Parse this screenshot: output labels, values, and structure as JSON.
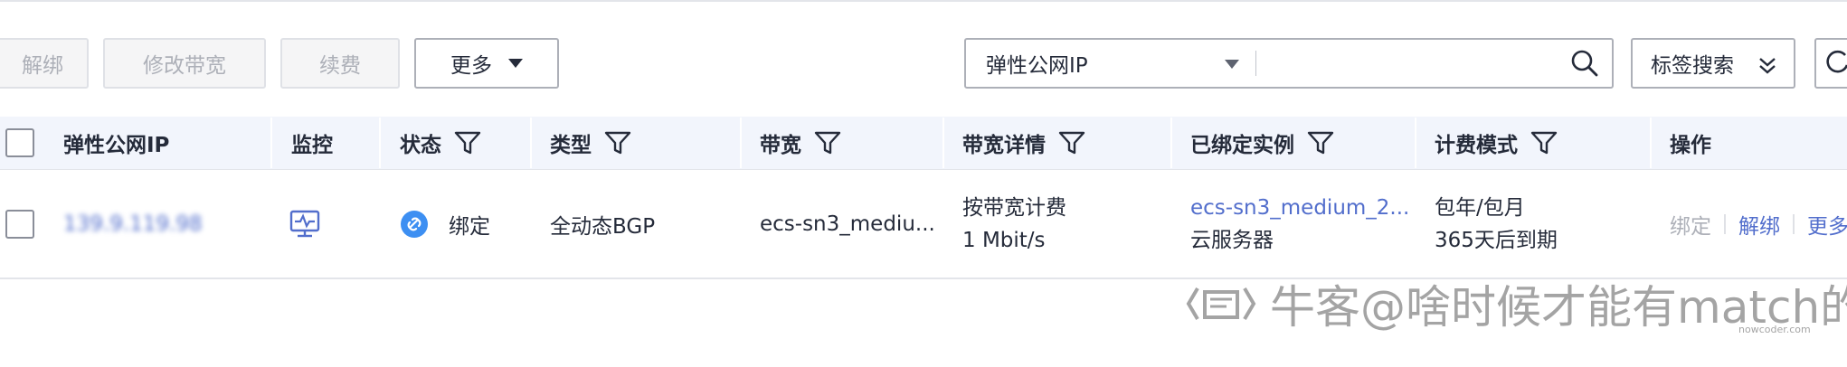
{
  "toolbar": {
    "unbind_label": "解绑",
    "modify_bandwidth_label": "修改带宽",
    "renew_label": "续费",
    "more_label": "更多"
  },
  "search": {
    "field_selected": "弹性公网IP",
    "query_value": "",
    "tag_search_label": "标签搜索"
  },
  "table": {
    "headers": {
      "eip": "弹性公网IP",
      "monitor": "监控",
      "status": "状态",
      "type": "类型",
      "bandwidth": "带宽",
      "bandwidth_detail": "带宽详情",
      "bound_instance": "已绑定实例",
      "billing": "计费模式",
      "actions": "操作"
    },
    "rows": [
      {
        "eip": "139.9.119.98",
        "status": "绑定",
        "type": "全动态BGP",
        "bandwidth": "ecs-sn3_mediu...",
        "bandwidth_billing": "按带宽计费",
        "bandwidth_size": "1 Mbit/s",
        "instance_name": "ecs-sn3_medium_2...",
        "instance_type": "云服务器",
        "billing_mode": "包年/包月",
        "expiry": "365天后到期",
        "actions": {
          "bind": "绑定",
          "unbind": "解绑",
          "more": "更多"
        }
      }
    ]
  },
  "watermark": {
    "text": "牛客@啥时候才能有match的o",
    "sub": "nowcoder.com"
  },
  "colors": {
    "link": "#526ecc",
    "header_bg": "#f2f5fc",
    "status_icon": "#3d8ff2"
  }
}
